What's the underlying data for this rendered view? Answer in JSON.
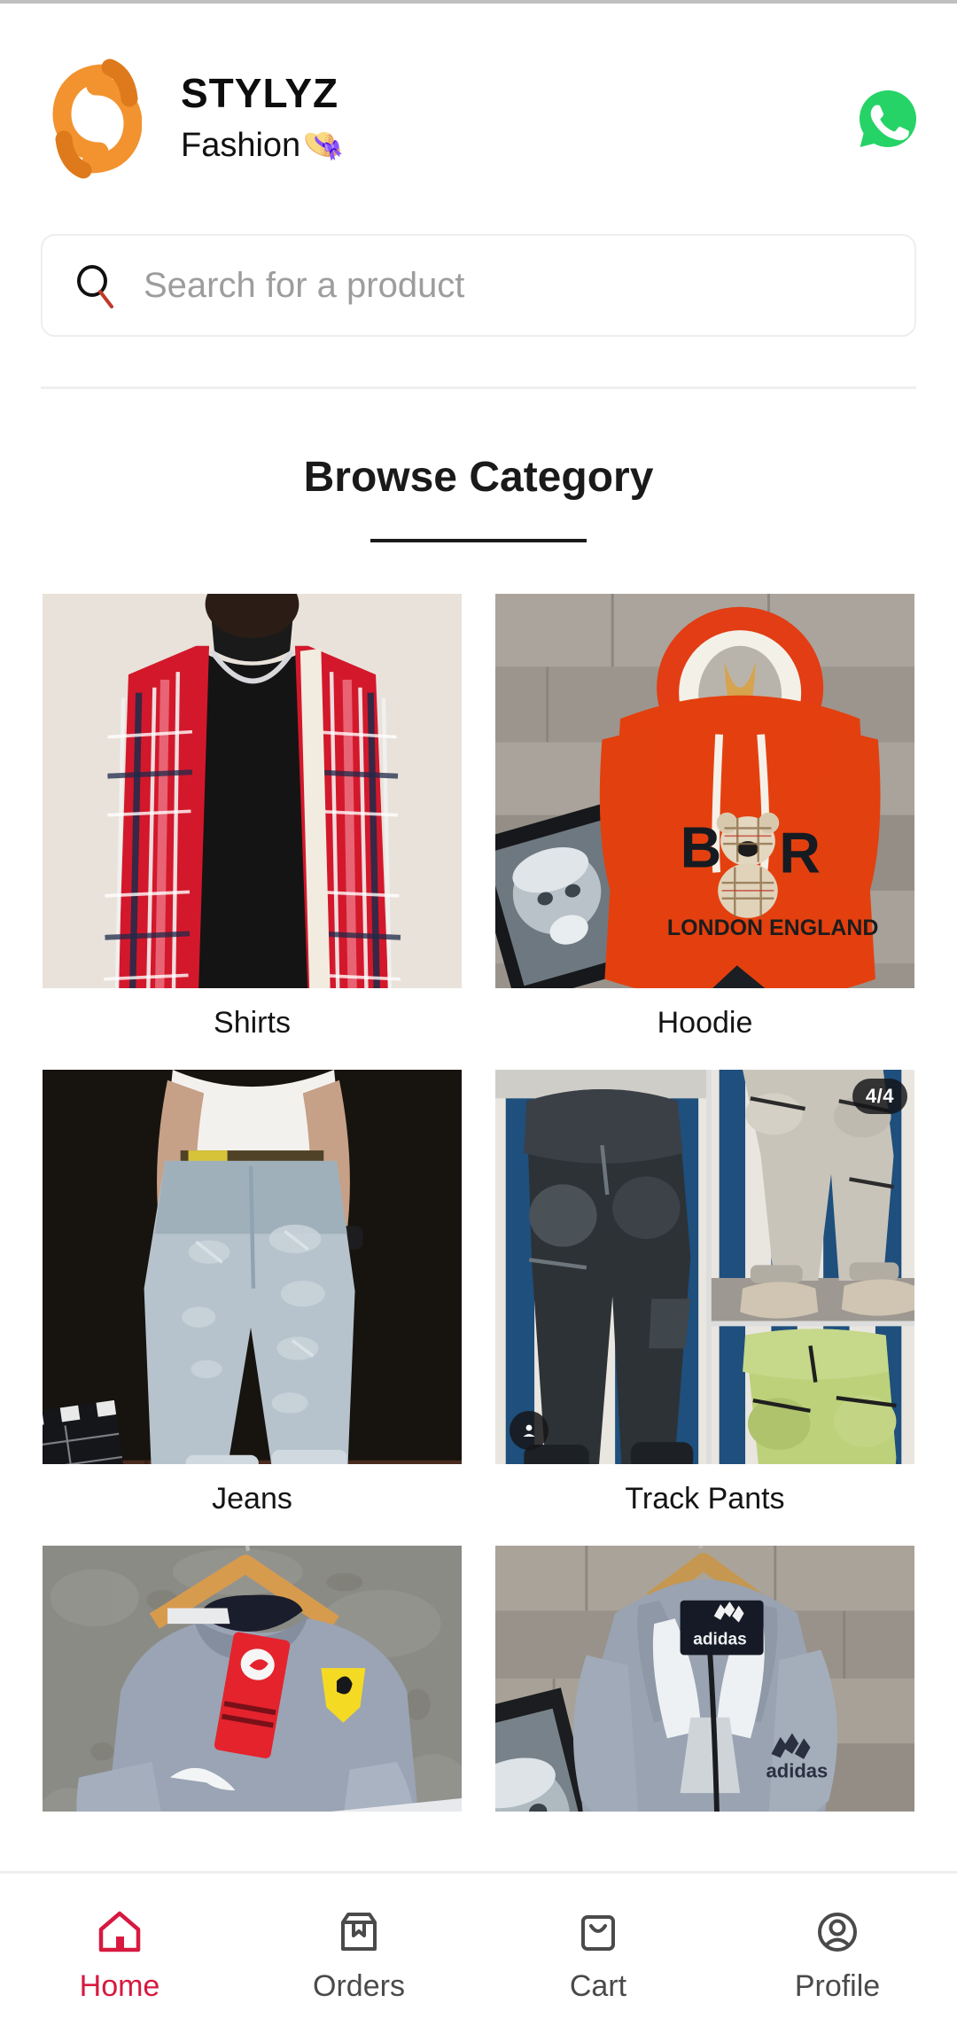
{
  "brand": {
    "name": "STYLYZ",
    "tagline": "Fashion",
    "tagline_emoji": "👒",
    "logo_icon": "stylyz-s-logo",
    "logo_color": "#F2932F",
    "whatsapp_icon": "whatsapp-icon",
    "whatsapp_color": "#25D366"
  },
  "search": {
    "placeholder": "Search for a product",
    "icon": "search-icon",
    "icon_ring_color": "#111111",
    "icon_handle_color": "#C0392B"
  },
  "browse": {
    "title": "Browse Category"
  },
  "categories": [
    {
      "label": "Shirts",
      "image": "red-plaid-flannel-shirt-on-model"
    },
    {
      "label": "Hoodie",
      "image": "orange-bear-hoodie-flatlay-on-wood"
    },
    {
      "label": "Jeans",
      "image": "light-washed-ripped-jeans-on-model"
    },
    {
      "label": "Track Pants",
      "image": "cargo-track-pants-collage",
      "count_badge": "4/4",
      "avatar_badge": "account-icon"
    },
    {
      "label": "",
      "image": "gray-puma-ferrari-sweatshirt-on-hanger"
    },
    {
      "label": "",
      "image": "gray-adidas-zip-jacket-on-hanger"
    }
  ],
  "bottom_nav": {
    "active_color": "#D7193F",
    "inactive_color": "#4A4A4A",
    "items": [
      {
        "label": "Home",
        "icon": "home-icon",
        "active": true
      },
      {
        "label": "Orders",
        "icon": "package-icon",
        "active": false
      },
      {
        "label": "Cart",
        "icon": "bag-icon",
        "active": false
      },
      {
        "label": "Profile",
        "icon": "person-icon",
        "active": false
      }
    ]
  }
}
